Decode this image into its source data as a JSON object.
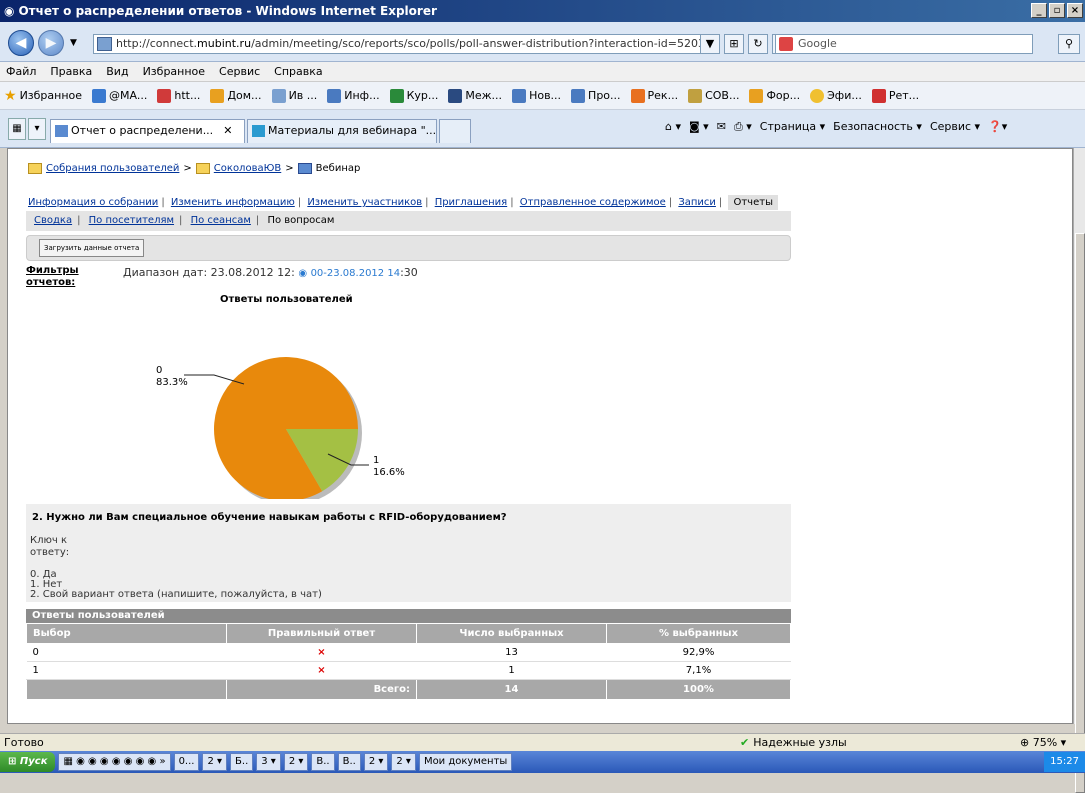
{
  "window": {
    "title": "Отчет о распределении ответов - Windows Internet Explorer"
  },
  "address": {
    "prefix": "http://connect.",
    "domain": "mubint.ru",
    "rest": "/admin/meeting/sco/reports/sco/polls/poll-answer-distribution?interaction-id=5203("
  },
  "search": {
    "placeholder": "Google"
  },
  "menu": [
    "Файл",
    "Правка",
    "Вид",
    "Избранное",
    "Сервис",
    "Справка"
  ],
  "favorites": {
    "label": "Избранное",
    "items": [
      "@MA...",
      "htt...",
      "Дом...",
      "Ив ...",
      "Инф...",
      "Кур...",
      "Меж...",
      "Нов...",
      "Про...",
      "Рек...",
      "СОВ...",
      "Фор...",
      "Эфи...",
      "Рет..."
    ]
  },
  "tabs": [
    {
      "label": "Отчет о распределени..."
    },
    {
      "label": "Материалы для вебинара \"..."
    }
  ],
  "commands": [
    "Страница ▾",
    "Безопасность ▾",
    "Сервис ▾"
  ],
  "breadcrumb": {
    "root": "Собрания пользователей",
    "folder": "СоколоваЮВ",
    "current": "Вебинар"
  },
  "toplinks": [
    "Информация о собрании",
    "Изменить информацию",
    "Изменить участников",
    "Приглашения",
    "Отправленное содержимое",
    "Записи"
  ],
  "toplinks_current": "Отчеты",
  "sublinks": [
    "Сводка",
    "По посетителям",
    "По сеансам"
  ],
  "sublinks_current": "По вопросам",
  "download_button": "Загрузить данные отчета",
  "filters_label": "Фильтры отчетов:",
  "range": {
    "prefix": "Диапазон дат: 23.08.2012 12:",
    "mid": "00-23.08.2012 14",
    "suffix": ":30"
  },
  "chart_data": {
    "type": "pie",
    "title": "Ответы пользователей",
    "categories": [
      "0",
      "1"
    ],
    "values": [
      83.3,
      16.6
    ],
    "labels": [
      "83.3%",
      "16.6%"
    ],
    "colors": [
      "#e8890c",
      "#a4c044"
    ]
  },
  "question": {
    "title": "2.   Нужно ли Вам специальное обучение навыкам работы с RFID-оборудованием?",
    "key_label": "Ключ к ответу:",
    "answers": [
      "0.  Да",
      "1.  Нет",
      "2.  Свой вариант ответа (напишите, пожалуйста, в чат)"
    ]
  },
  "results": {
    "title": "Ответы пользователей",
    "headers": [
      "Выбор",
      "Правильный ответ",
      "Число выбранных",
      "% выбранных"
    ],
    "rows": [
      {
        "choice": "0",
        "correct": "×",
        "count": "13",
        "percent": "92,9%"
      },
      {
        "choice": "1",
        "correct": "×",
        "count": "1",
        "percent": "7,1%"
      }
    ],
    "total_label": "Всего:",
    "total_count": "14",
    "total_percent": "100%"
  },
  "status": {
    "ready": "Готово",
    "zone": "Надежные узлы",
    "zoom": "75%"
  },
  "taskbar": {
    "start": "Пуск",
    "items": [
      "0...",
      "2 ▾",
      "Б..",
      "3 ▾",
      "2 ▾",
      "В..",
      "В..",
      "2 ▾",
      "2 ▾",
      "Мои документы"
    ],
    "clock": "15:27"
  }
}
